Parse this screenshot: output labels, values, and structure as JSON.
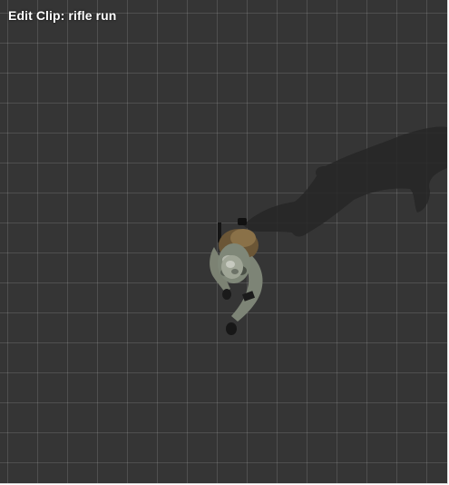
{
  "viewport": {
    "title": "Edit Clip: rifle run",
    "background_color": "#353535",
    "grid_color": "#5a5a5a"
  },
  "scene": {
    "character_icon": "soldier-top-down-figure",
    "shadow_icon": "character-shadow"
  }
}
